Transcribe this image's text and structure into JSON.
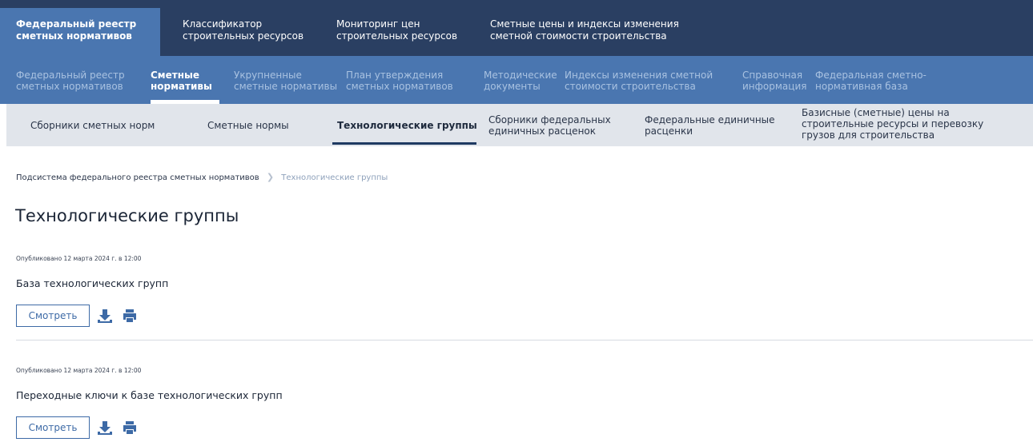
{
  "top_nav": [
    {
      "line1": "Федеральный реестр",
      "line2": "сметных нормативов"
    },
    {
      "line1": "Классификатор",
      "line2": "строительных ресурсов"
    },
    {
      "line1": "Мониторинг цен",
      "line2": "строительных ресурсов"
    },
    {
      "line1": "Сметные цены и индексы изменения",
      "line2": "сметной стоимости строительства"
    }
  ],
  "sub_nav": [
    {
      "line1": "Федеральный реестр",
      "line2": "сметных нормативов"
    },
    {
      "line1": "Сметные",
      "line2": "нормативы"
    },
    {
      "line1": "Укрупненные",
      "line2": "сметные нормативы"
    },
    {
      "line1": "План утверждения",
      "line2": "сметных нормативов"
    },
    {
      "line1": "Методические",
      "line2": "документы"
    },
    {
      "line1": "Индексы изменения сметной",
      "line2": "стоимости строительства"
    },
    {
      "line1": "Справочная",
      "line2": "информация"
    },
    {
      "line1": "Федеральная сметно-",
      "line2": "нормативная база"
    }
  ],
  "third_nav": [
    {
      "line1": "Сборники сметных норм",
      "line2": "",
      "line3": ""
    },
    {
      "line1": "Сметные нормы",
      "line2": "",
      "line3": ""
    },
    {
      "line1": "Технологические группы",
      "line2": "",
      "line3": ""
    },
    {
      "line1": "Сборники федеральных",
      "line2": "единичных расценок",
      "line3": ""
    },
    {
      "line1": "Федеральные единичные",
      "line2": "расценки",
      "line3": ""
    },
    {
      "line1": "Базисные (сметные) цены на",
      "line2": "строительные ресурсы и перевозку",
      "line3": "грузов для строительства"
    }
  ],
  "breadcrumb": {
    "root": "Подсистема федерального реестра сметных нормативов",
    "separator": "❯",
    "current": "Технологические группы"
  },
  "page_title": "Технологические группы",
  "documents": [
    {
      "published": "Опубликовано 12 марта 2024 г. в 12:00",
      "title": "База технологических групп",
      "view_label": "Смотреть"
    },
    {
      "published": "Опубликовано 12 марта 2024 г. в 12:00",
      "title": "Переходные ключи к базе технологических групп",
      "view_label": "Смотреть"
    }
  ],
  "colors": {
    "top_nav": "#2a3f62",
    "sub_nav": "#4a76b0",
    "third_nav": "#e1e5eb",
    "accent": "#3d6aa6"
  },
  "icons": {
    "download": "download-icon",
    "print": "print-icon"
  }
}
